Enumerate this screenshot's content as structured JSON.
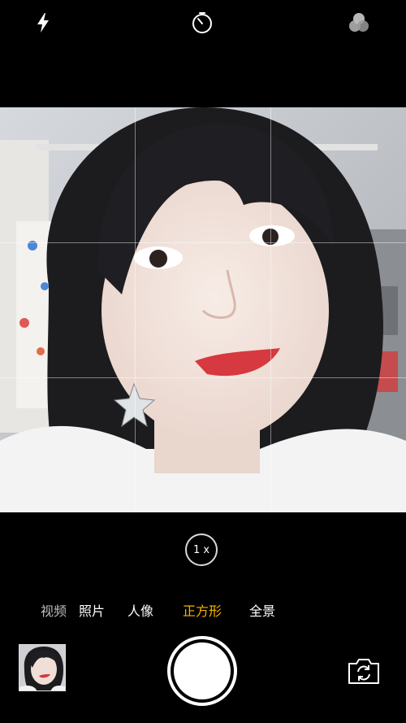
{
  "top_bar": {
    "flash_icon": "lightning-bolt",
    "timer_icon": "timer",
    "filters_icon": "three-circles"
  },
  "zoom": {
    "label": "1 x"
  },
  "modes": [
    {
      "label": "视频",
      "state": "dim"
    },
    {
      "label": "照片",
      "state": "normal"
    },
    {
      "label": "人像",
      "state": "normal"
    },
    {
      "label": "正方形",
      "state": "active"
    },
    {
      "label": "全景",
      "state": "normal"
    }
  ],
  "colors": {
    "active_mode": "#f5b400",
    "background": "#000000",
    "shutter": "#ffffff"
  }
}
